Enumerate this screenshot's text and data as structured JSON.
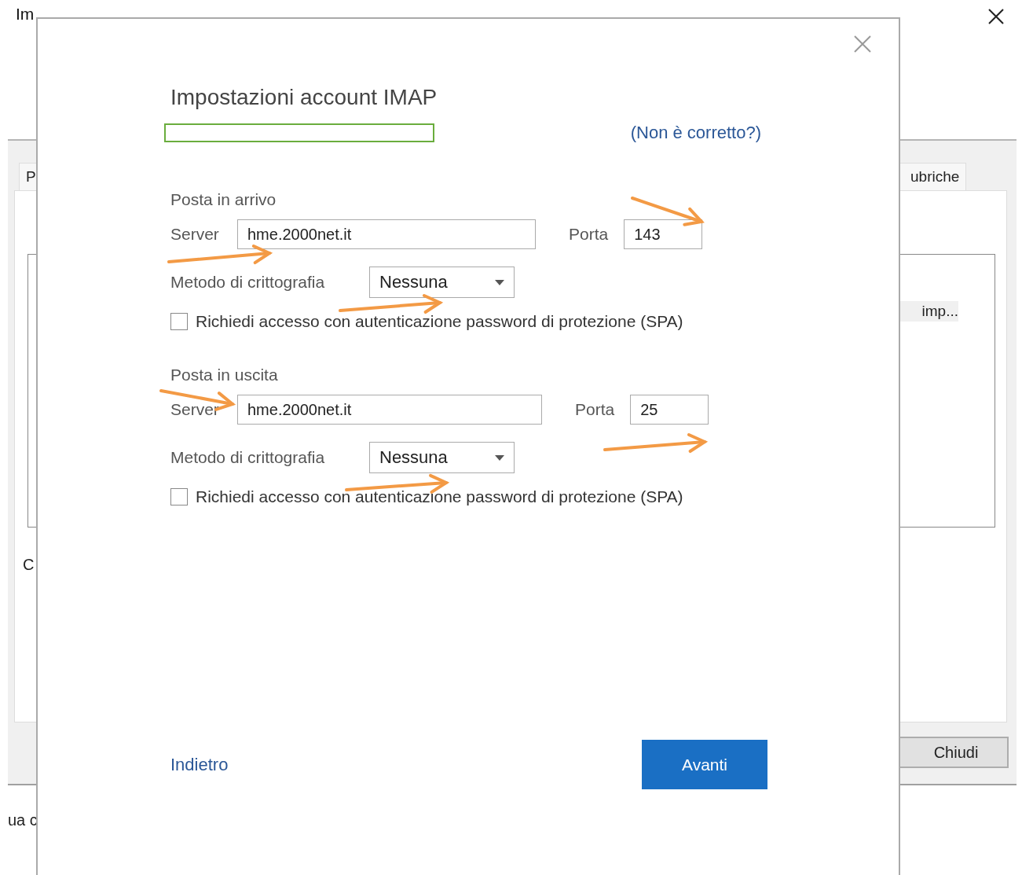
{
  "background_window": {
    "title": "Im",
    "tabs": [
      {
        "label": "P"
      },
      {
        "label": "ubriche"
      }
    ],
    "list_item": "imp...",
    "side_label": "C",
    "footer_text": "ua c",
    "close_button": "Chiudi"
  },
  "dialog": {
    "title": "Impostazioni account IMAP",
    "link": "(Non è corretto?)",
    "sections": [
      {
        "heading": "Posta in arrivo",
        "server_label": "Server",
        "server": "hme.2000net.it",
        "port_label": "Porta",
        "port": "143",
        "encryption_label": "Metodo di crittografia",
        "encryption": "Nessuna",
        "spa_label": "Richiedi accesso con autenticazione password di protezione (SPA)",
        "spa_checked": false
      },
      {
        "heading": "Posta in uscita",
        "server_label": "Server",
        "server": "hme.2000net.it",
        "port_label": "Porta",
        "port": "25",
        "encryption_label": "Metodo di crittografia",
        "encryption": "Nessuna",
        "spa_label": "Richiedi accesso con autenticazione password di protezione (SPA)",
        "spa_checked": false
      }
    ],
    "back": "Indietro",
    "next": "Avanti"
  }
}
